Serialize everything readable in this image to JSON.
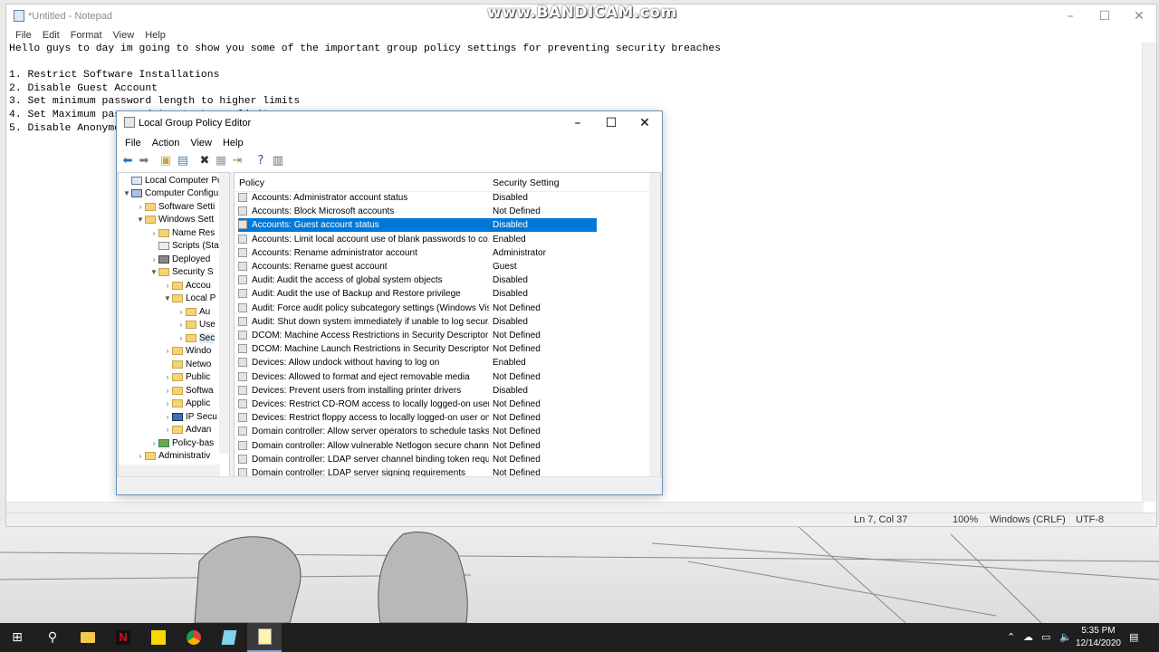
{
  "watermark": "www.BANDICAM.com",
  "notepad": {
    "title": "*Untitled - Notepad",
    "menu": [
      "File",
      "Edit",
      "Format",
      "View",
      "Help"
    ],
    "text": "Hello guys to day im going to show you some of the important group policy settings for preventing security breaches\n\n1. Restrict Software Installations\n2. Disable Guest Account\n3. Set minimum password length to higher limits\n4. Set Maximum password Age to Lower limits\n5. Disable Anonymous",
    "status": {
      "position": "Ln 7, Col 37",
      "zoom": "100%",
      "eol": "Windows (CRLF)",
      "encoding": "UTF-8"
    }
  },
  "gpo": {
    "title": "Local Group Policy Editor",
    "menu": [
      "File",
      "Action",
      "View",
      "Help"
    ],
    "tree": [
      {
        "label": "Local Computer Polic",
        "expander": ""
      },
      {
        "label": "Computer Configu",
        "expander": "▼"
      },
      {
        "label": "Software Setti",
        "expander": "›"
      },
      {
        "label": "Windows Sett",
        "expander": "▼"
      },
      {
        "label": "Name Res",
        "expander": "›"
      },
      {
        "label": "Scripts (Sta",
        "expander": ""
      },
      {
        "label": "Deployed",
        "expander": "›"
      },
      {
        "label": "Security S",
        "expander": "▼"
      },
      {
        "label": "Accou",
        "expander": "›"
      },
      {
        "label": "Local P",
        "expander": "▼"
      },
      {
        "label": "Au",
        "expander": "›"
      },
      {
        "label": "Use",
        "expander": "›"
      },
      {
        "label": "Sec",
        "expander": "›"
      },
      {
        "label": "Windo",
        "expander": "›"
      },
      {
        "label": "Netwo",
        "expander": ""
      },
      {
        "label": "Public",
        "expander": "›"
      },
      {
        "label": "Softwa",
        "expander": "›"
      },
      {
        "label": "Applic",
        "expander": "›"
      },
      {
        "label": "IP Secu",
        "expander": "›"
      },
      {
        "label": "Advan",
        "expander": "›"
      },
      {
        "label": "Policy-bas",
        "expander": "›"
      },
      {
        "label": "Administrativ",
        "expander": "›"
      }
    ],
    "columns": {
      "policy": "Policy",
      "setting": "Security Setting"
    },
    "rows": [
      {
        "policy": "Accounts: Administrator account status",
        "setting": "Disabled"
      },
      {
        "policy": "Accounts: Block Microsoft accounts",
        "setting": "Not Defined"
      },
      {
        "policy": "Accounts: Guest account status",
        "setting": "Disabled"
      },
      {
        "policy": "Accounts: Limit local account use of blank passwords to co...",
        "setting": "Enabled"
      },
      {
        "policy": "Accounts: Rename administrator account",
        "setting": "Administrator"
      },
      {
        "policy": "Accounts: Rename guest account",
        "setting": "Guest"
      },
      {
        "policy": "Audit: Audit the access of global system objects",
        "setting": "Disabled"
      },
      {
        "policy": "Audit: Audit the use of Backup and Restore privilege",
        "setting": "Disabled"
      },
      {
        "policy": "Audit: Force audit policy subcategory settings (Windows Vis...",
        "setting": "Not Defined"
      },
      {
        "policy": "Audit: Shut down system immediately if unable to log secur...",
        "setting": "Disabled"
      },
      {
        "policy": "DCOM: Machine Access Restrictions in Security Descriptor D...",
        "setting": "Not Defined"
      },
      {
        "policy": "DCOM: Machine Launch Restrictions in Security Descriptor ...",
        "setting": "Not Defined"
      },
      {
        "policy": "Devices: Allow undock without having to log on",
        "setting": "Enabled"
      },
      {
        "policy": "Devices: Allowed to format and eject removable media",
        "setting": "Not Defined"
      },
      {
        "policy": "Devices: Prevent users from installing printer drivers",
        "setting": "Disabled"
      },
      {
        "policy": "Devices: Restrict CD-ROM access to locally logged-on user ...",
        "setting": "Not Defined"
      },
      {
        "policy": "Devices: Restrict floppy access to locally logged-on user only",
        "setting": "Not Defined"
      },
      {
        "policy": "Domain controller: Allow server operators to schedule tasks",
        "setting": "Not Defined"
      },
      {
        "policy": "Domain controller: Allow vulnerable Netlogon secure chann...",
        "setting": "Not Defined"
      },
      {
        "policy": "Domain controller: LDAP server channel binding token requi...",
        "setting": "Not Defined"
      },
      {
        "policy": "Domain controller: LDAP server signing requirements",
        "setting": "Not Defined"
      }
    ]
  },
  "taskbar": {
    "apps": [
      "start-icon",
      "search-icon",
      "file-explorer-icon",
      "netflix-icon",
      "sticky-notes-icon",
      "chrome-icon",
      "unknown-app-icon",
      "notepad-icon"
    ],
    "time": "5:35 PM",
    "date": "12/14/2020"
  }
}
